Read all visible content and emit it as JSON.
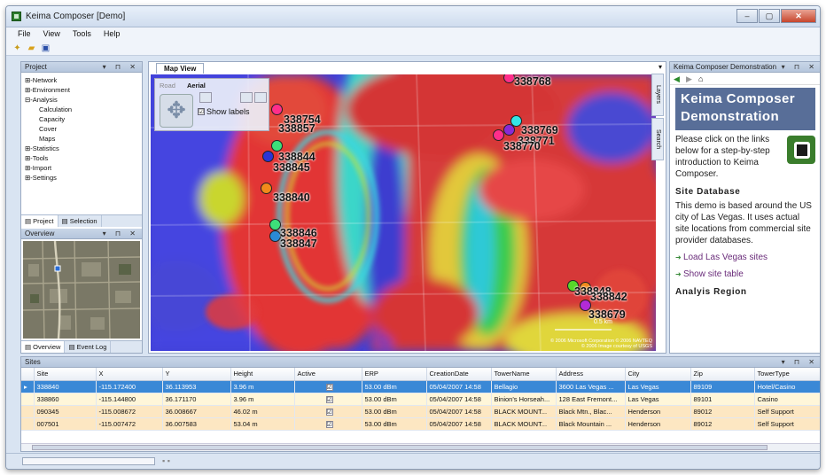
{
  "window": {
    "title": "Keima Composer [Demo]",
    "controls": [
      "–",
      "▢",
      "✕"
    ]
  },
  "menu": [
    "File",
    "View",
    "Tools",
    "Help"
  ],
  "project_panel": {
    "title": "Project",
    "tree": [
      {
        "label": "Network",
        "level": 0,
        "prefix": "⊞-"
      },
      {
        "label": "Environment",
        "level": 0,
        "prefix": "⊞-"
      },
      {
        "label": "Analysis",
        "level": 0,
        "prefix": "⊟-"
      },
      {
        "label": "Calculation",
        "level": 1,
        "prefix": ""
      },
      {
        "label": "Capacity",
        "level": 1,
        "prefix": ""
      },
      {
        "label": "Cover",
        "level": 1,
        "prefix": ""
      },
      {
        "label": "Maps",
        "level": 1,
        "prefix": ""
      },
      {
        "label": "Statistics",
        "level": 0,
        "prefix": "⊞-"
      },
      {
        "label": "Tools",
        "level": 0,
        "prefix": "⊞-"
      },
      {
        "label": "Import",
        "level": 0,
        "prefix": "⊞-"
      },
      {
        "label": "Settings",
        "level": 0,
        "prefix": "⊞-"
      }
    ],
    "tabs": [
      "Project",
      "Selection"
    ]
  },
  "overview_panel": {
    "title": "Overview",
    "tabs": [
      "Overview",
      "Event Log"
    ]
  },
  "map": {
    "tab": "Map View",
    "road": "Road",
    "aerial": "Aerial",
    "show_labels": "Show labels",
    "show_labels_checked": "☑",
    "copyright": "© 2006 Microsoft Corporation © 2006 NAVTEQ\n© 2006 Image courtesy of USGS",
    "scale": "0.5 km",
    "sites": [
      {
        "id": "338768",
        "color": "#ff2e8a"
      },
      {
        "id": "338754",
        "color": "#ff2e8a"
      },
      {
        "id": "338857",
        "color": "#ff2e8a"
      },
      {
        "id": "338844",
        "color": "#3de07a"
      },
      {
        "id": "338845",
        "color": "#2a35d6"
      },
      {
        "id": "338840",
        "color": "#f28a1b"
      },
      {
        "id": "338846",
        "color": "#3de07a"
      },
      {
        "id": "338847",
        "color": "#2a8ad6"
      },
      {
        "id": "338769",
        "color": "#34e6e6"
      },
      {
        "id": "338771",
        "color": "#8a2ad6"
      },
      {
        "id": "338770",
        "color": "#ff2e8a"
      },
      {
        "id": "338848",
        "color": "#57d62a"
      },
      {
        "id": "338842",
        "color": "#f28a1b"
      },
      {
        "id": "338679",
        "color": "#b32ad6"
      }
    ],
    "side_tabs": [
      "Layers",
      "Search"
    ]
  },
  "right_panel": {
    "title": "Keima Composer Demonstration",
    "banner": "Keima Composer Demonstration",
    "intro": "Please click on the links below for a step-by-step introduction to Keima Composer.",
    "h1": "Site Database",
    "p1": "This demo is based around the US city of Las Vegas. It uses actual site locations from commercial site provider databases.",
    "link1": "Load Las Vegas sites",
    "link2": "Show site table",
    "h2": "Analyis Region"
  },
  "sites_table": {
    "title": "Sites",
    "columns": [
      "Site",
      "X",
      "Y",
      "Height",
      "Active",
      "ERP",
      "CreationDate",
      "TowerName",
      "Address",
      "City",
      "Zip",
      "TowerType"
    ],
    "rows": [
      [
        "338840",
        "-115.172400",
        "36.113953",
        "3.96 m",
        "☑",
        "53.00 dBm",
        "05/04/2007 14:58",
        "Bellagio",
        "3600 Las Vegas ...",
        "Las Vegas",
        "89109",
        "Hotel/Casino"
      ],
      [
        "338860",
        "-115.144800",
        "36.171170",
        "3.96 m",
        "☑",
        "53.00 dBm",
        "05/04/2007 14:58",
        "Binion's Horseah...",
        "128 East Fremont...",
        "Las Vegas",
        "89101",
        "Casino"
      ],
      [
        "090345",
        "-115.008672",
        "36.008667",
        "46.02 m",
        "☑",
        "53.00 dBm",
        "05/04/2007 14:58",
        "BLACK MOUNT...",
        "Black Mtn., Blac...",
        "Henderson",
        "89012",
        "Self Support"
      ],
      [
        "007501",
        "-115.007472",
        "36.007583",
        "53.04 m",
        "☑",
        "53.00 dBm",
        "05/04/2007 14:58",
        "BLACK MOUNT...",
        "Black Mountain ...",
        "Henderson",
        "89012",
        "Self Support"
      ]
    ]
  }
}
